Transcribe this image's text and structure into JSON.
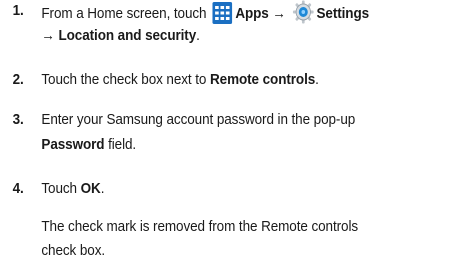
{
  "steps": [
    {
      "number": "1.",
      "line1_prefix": "From a Home screen, touch",
      "apps_label": "Apps",
      "arrow1": "→",
      "settings_label": "Settings",
      "arrow2": "→",
      "location_label": "Location and security",
      "period": "."
    },
    {
      "number": "2.",
      "prefix": "Touch the check box next to",
      "bold": "Remote controls",
      "suffix": "."
    },
    {
      "number": "3.",
      "line1": "Enter your Samsung account password in the pop-up",
      "bold": "Password",
      "suffix": " field."
    },
    {
      "number": "4.",
      "prefix": "Touch",
      "bold": "OK",
      "suffix": "."
    }
  ],
  "note": {
    "line1": "The check mark is removed from the Remote controls",
    "line2": "check box."
  },
  "icons": {
    "apps": "apps-grid-icon",
    "settings": "settings-gear-icon",
    "apps_color": "#1b6fc2",
    "settings_color": "#1e88d6"
  }
}
